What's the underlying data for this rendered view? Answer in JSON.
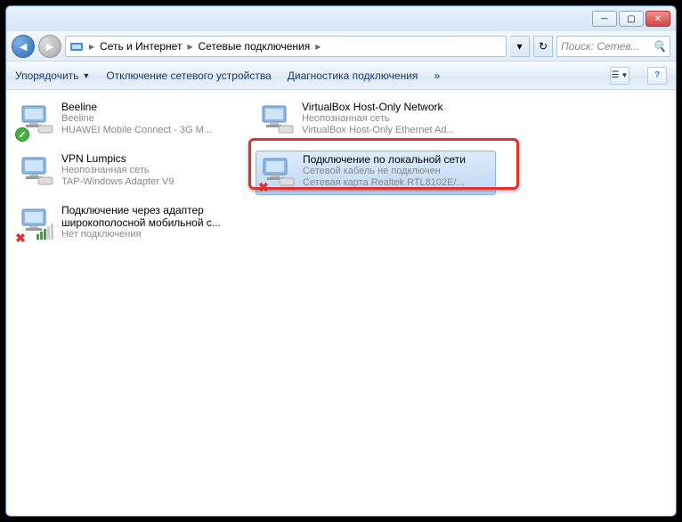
{
  "window": {
    "min_tooltip": "Minimize",
    "max_tooltip": "Maximize",
    "close_tooltip": "Close"
  },
  "breadcrumb": {
    "seg1": "Сеть и Интернет",
    "seg2": "Сетевые подключения"
  },
  "search": {
    "placeholder": "Поиск: Сетев..."
  },
  "toolbar": {
    "organize": "Упорядочить",
    "disable": "Отключение сетевого устройства",
    "diagnose": "Диагностика подключения",
    "more": "»"
  },
  "items": [
    {
      "title": "Beeline",
      "line2": "Beeline",
      "line3": "HUAWEI Mobile Connect - 3G M...",
      "badge": "check"
    },
    {
      "title": "VirtualBox Host-Only Network",
      "line2": "Неопознанная сеть",
      "line3": "VirtualBox Host-Only Ethernet Ad...",
      "badge": ""
    },
    {
      "title": "VPN Lumpics",
      "line2": "Неопознанная сеть",
      "line3": "TAP-Windows Adapter V9",
      "badge": ""
    },
    {
      "title": "Подключение по локальной сети",
      "line2": "Сетевой кабель не подключен",
      "line3": "Сетевая карта Realtek RTL8102E/...",
      "badge": "cross",
      "selected": true
    },
    {
      "title": "Подключение через адаптер широкополосной мобильной с...",
      "line2": "Нет подключения",
      "line3": "",
      "badge": "bars-cross"
    }
  ]
}
